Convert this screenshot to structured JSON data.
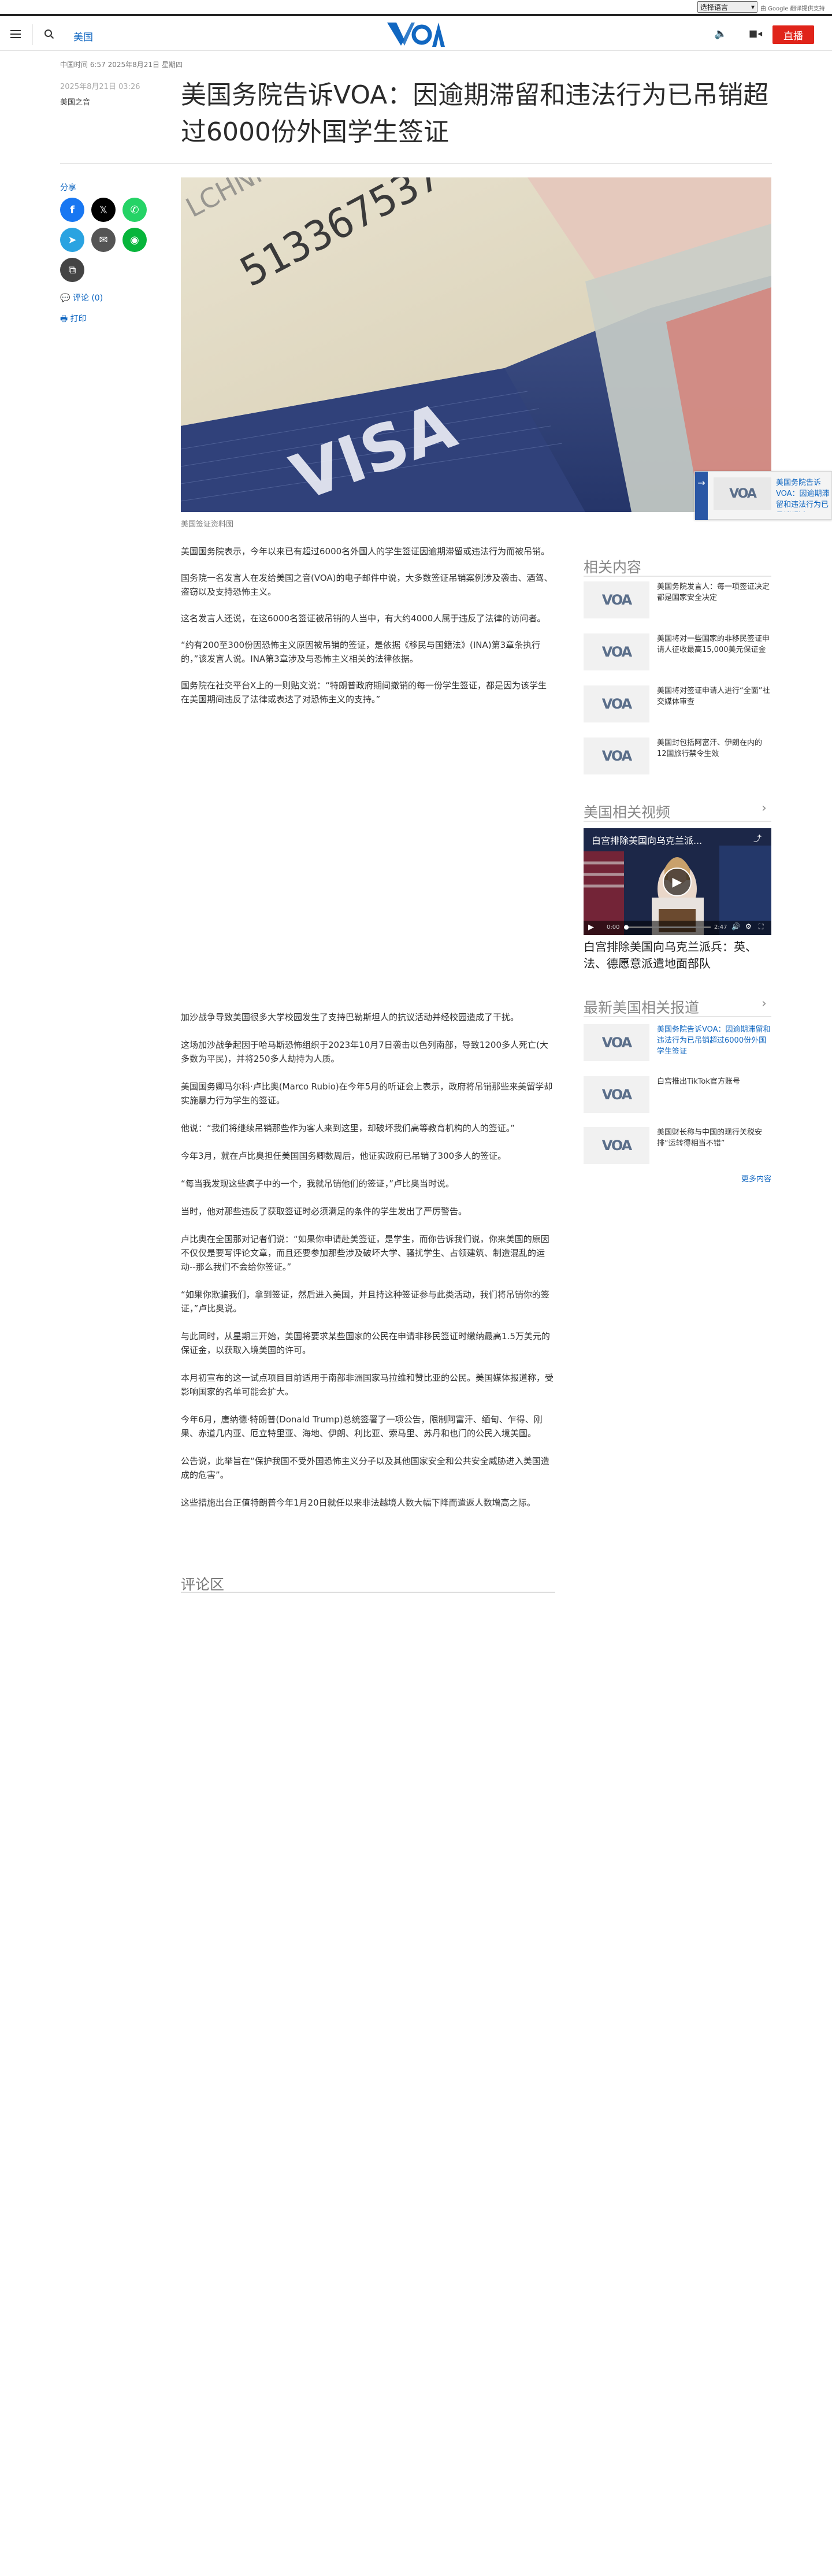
{
  "top": {
    "language_select": "选择语言",
    "google_translate": "由 Google 翻译提供支持",
    "google_brand": "翻译"
  },
  "nav": {
    "section": "美国",
    "logo_text": "VOA",
    "live": "直播"
  },
  "article": {
    "timezone_line": "中国时间 6:57 2025年8月21日 星期四",
    "date": "2025年8月21日 03:26",
    "byline": "美国之音",
    "title": "美国务院告诉VOA：因逾期滞留和违法行为已吊销超过6000份外国学生签证",
    "share_label": "分享",
    "comments_link": "评论 (0)",
    "print_link": "打印",
    "image_caption": "美国签证资料图",
    "image_visa_text": "VISA",
    "image_number_text": "513367537",
    "paragraphs_a": [
      "美国国务院表示，今年以来已有超过6000名外国人的学生签证因逾期滞留或违法行为而被吊销。",
      "国务院一名发言人在发给美国之音(VOA)的电子邮件中说，大多数签证吊销案例涉及袭击、酒驾、盗窃以及支持恐怖主义。",
      "这名发言人还说，在这6000名签证被吊销的人当中，有大约4000人属于违反了法律的访问者。",
      "“约有200至300份因恐怖主义原因被吊销的签证，是依据《移民与国籍法》(INA)第3章条执行的，”该发言人说。INA第3章涉及与恐怖主义相关的法律依据。",
      "国务院在社交平台X上的一则贴文说：“特朗普政府期间撤销的每一份学生签证，都是因为该学生在美国期间违反了法律或表达了对恐怖主义的支持。”"
    ],
    "paragraphs_b": [
      "加沙战争导致美国很多大学校园发生了支持巴勒斯坦人的抗议活动并经校园造成了干扰。",
      "这场加沙战争起因于哈马斯恐怖组织于2023年10月7日袭击以色列南部，导致1200多人死亡(大多数为平民)，并将250多人劫持为人质。",
      "美国国务卿马尔科·卢比奥(Marco Rubio)在今年5月的听证会上表示，政府将吊销那些来美留学却实施暴力行为学生的签证。",
      "他说：“我们将继续吊销那些作为客人来到这里，却破坏我们高等教育机构的人的签证。”",
      "今年3月，就在卢比奥担任美国国务卿数周后，他证实政府已吊销了300多人的签证。",
      "“每当我发现这些疯子中的一个，我就吊销他们的签证，”卢比奥当时说。",
      "当时，他对那些违反了获取签证时必须满足的条件的学生发出了严厉警告。",
      "卢比奥在全国那对记者们说：“如果你申请赴美签证，是学生，而你告诉我们说，你来美国的原因不仅仅是要写评论文章，而且还要参加那些涉及破坏大学、骚扰学生、占领建筑、制造混乱的运动--那么我们不会给你签证。”",
      "“如果你欺骗我们，拿到签证，然后进入美国，并且持这种签证参与此类活动，我们将吊销你的签证，”卢比奥说。",
      "与此同时，从星期三开始，美国将要求某些国家的公民在申请非移民签证时缴纳最高1.5万美元的保证金，以获取入境美国的许可。",
      "本月初宣布的这一试点项目目前适用于南部非洲国家马拉维和赞比亚的公民。美国媒体报道称，受影响国家的名单可能会扩大。",
      "今年6月，唐纳德·特朗普(Donald Trump)总统签署了一项公告，限制阿富汗、缅甸、乍得、刚果、赤道几内亚、厄立特里亚、海地、伊朗、利比亚、索马里、苏丹和也门的公民入境美国。",
      "公告说，此举旨在“保护我国不受外国恐怖主义分子以及其他国家安全和公共安全威胁进入美国造成的危害”。",
      "这些措施出台正值特朗普今年1月20日就任以来非法越境人数大幅下降而遣返人数增高之际。"
    ],
    "comments_heading": "评论区"
  },
  "sidebar": {
    "related_heading": "相关内容",
    "related_items": [
      "美国务院发言人：每一项签证决定都是国家安全决定",
      "美国将对一些国家的非移民签证申请人征收最高15,000美元保证金",
      "美国将对签证申请人进行“全面”社交媒体审查",
      "美国封包括阿富汗、伊朗在内的12国旅行禁令生效"
    ],
    "videos_heading": "美国相关视频",
    "video_overlay_title": "白宫排除美国向乌克兰派...",
    "video_time": "0:00",
    "video_duration": "2:47",
    "video_title": "白宫排除美国向乌克兰派兵：英、法、德愿意派遣地面部队",
    "latest_heading": "最新美国相关报道",
    "latest_items": [
      "美国务院告诉VOA：因逾期滞留和违法行为已吊销超过6000份外国学生签证",
      "白宫推出TikTok官方账号",
      "美国财长称与中国的现行关税安排“运转得相当不错”"
    ],
    "more_link": "更多内容"
  },
  "popup": {
    "text": "美国务院告诉VOA：因逾期滞留和违法行为已吊销超过6000份外国学生签证"
  },
  "colors": {
    "brand_blue": "#1167c1",
    "live_red": "#e0241a",
    "facebook": "#1877f2",
    "x": "#000000",
    "whatsapp": "#25d366",
    "telegram": "#2aa3e1",
    "email": "#555555",
    "line": "#07b53b",
    "copy": "#444444"
  },
  "icons": [
    "menu-icon",
    "search-icon",
    "speaker-icon",
    "camera-icon",
    "facebook-icon",
    "x-icon",
    "whatsapp-icon",
    "telegram-icon",
    "email-icon",
    "line-icon",
    "copy-link-icon",
    "comment-icon",
    "print-icon",
    "chevron-right-icon",
    "play-icon",
    "share-icon"
  ]
}
